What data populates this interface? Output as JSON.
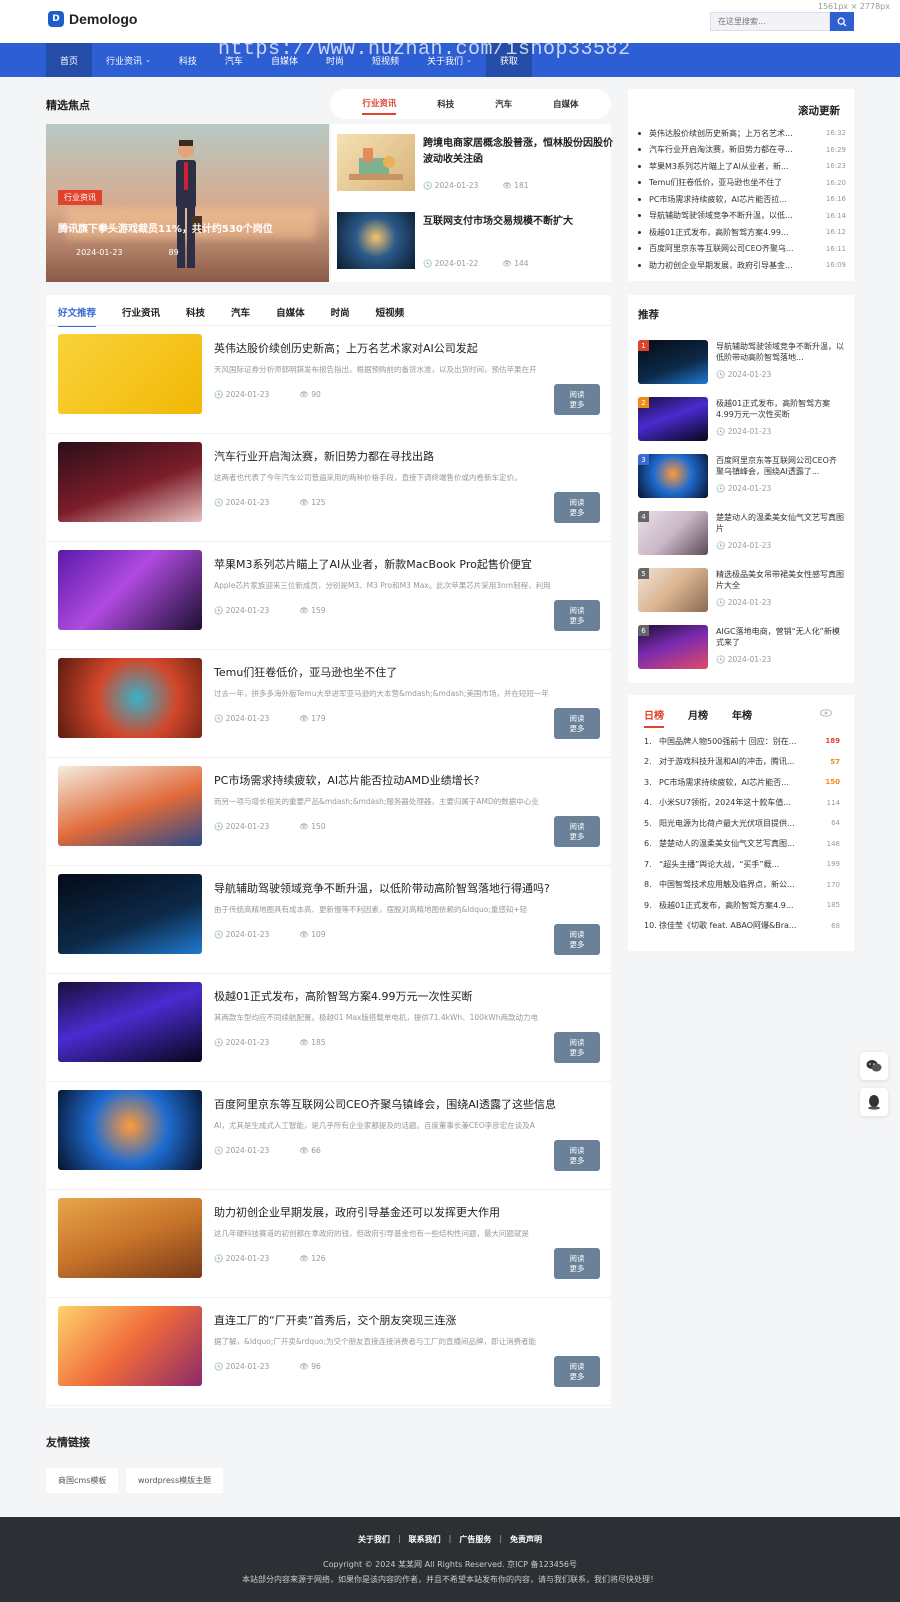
{
  "header": {
    "logo_mark": "D",
    "logo_text": "Demologo",
    "dims_label": "1561px × 2778px",
    "search_placeholder": "在这里搜索...",
    "watermark": "https://www.huzhan.com/ishop33582"
  },
  "nav": [
    "首页",
    "行业资讯",
    "科技",
    "汽车",
    "自媒体",
    "时尚",
    "短视频",
    "关于我们",
    "获取"
  ],
  "featured": {
    "title": "精选焦点",
    "tabs": [
      "行业资讯",
      "科技",
      "汽车",
      "自媒体"
    ],
    "hero": {
      "badge": "行业资讯",
      "title": "腾讯旗下拳头游戏裁员11%，共计约530个岗位",
      "date": "2024-01-23",
      "views": "89"
    },
    "side": [
      {
        "title": "跨境电商家居概念股普涨，恒林股份因股价波动收关注函",
        "date": "2024-01-23",
        "views": "181"
      },
      {
        "title": "互联网支付市场交易规模不断扩大",
        "date": "2024-01-22",
        "views": "144"
      }
    ]
  },
  "list": {
    "tabs": [
      "好文推荐",
      "行业资讯",
      "科技",
      "汽车",
      "自媒体",
      "时尚",
      "短视频"
    ],
    "button_label": "阅读\n更多",
    "articles": [
      {
        "title": "英伟达股价续创历史新高；上万名艺术家对AI公司发起",
        "excerpt": "天风国际证券分析师郭明錤发布报告指出，根据预购前的备货水准，以及出货时间，预估苹果在开",
        "date": "2024-01-23",
        "views": "90"
      },
      {
        "title": "汽车行业开启淘汰赛，新旧势力都在寻找出路",
        "excerpt": "这两者也代表了今年汽车公司普遍采用的两种价格手段，直接下调终端售价或内卷新车定价。",
        "date": "2024-01-23",
        "views": "125"
      },
      {
        "title": "苹果M3系列芯片瞄上了AI从业者，新款MacBook Pro起售价便宜",
        "excerpt": "Apple芯片家族迎来三位新成员，分别是M3、M3 Pro和M3 Max。此次苹果芯片采用3nm制程，利用",
        "date": "2024-01-23",
        "views": "159"
      },
      {
        "title": "Temu们狂卷低价，亚马逊也坐不住了",
        "excerpt": "过去一年，拼多多海外版Temu大举进军亚马逊的大本营&mdash;&mdash;美国市场，并在短短一年",
        "date": "2024-01-23",
        "views": "179"
      },
      {
        "title": "PC市场需求持续疲软，AI芯片能否拉动AMD业绩增长?",
        "excerpt": "而另一项与增长相关的重要产品&mdash;&mdash;服务器处理器，主要归属于AMD的数据中心业",
        "date": "2024-01-23",
        "views": "150"
      },
      {
        "title": "导航辅助驾驶领域竞争不断升温，以低阶带动高阶智驾落地行得通吗?",
        "excerpt": "由于传统高精地图具有成本高、更新慢等不利因素，摆脱对高精地图依赖的&ldquo;重感知+轻",
        "date": "2024-01-23",
        "views": "109"
      },
      {
        "title": "极越01正式发布，高阶智驾方案4.99万元一次性买断",
        "excerpt": "其两款车型均应不同续航配置。极越01 Max版搭载单电机，提供71.4kWh、100kWh两款动力电",
        "date": "2024-01-23",
        "views": "185"
      },
      {
        "title": "百度阿里京东等互联网公司CEO齐聚乌镇峰会，围绕AI透露了这些信息",
        "excerpt": "AI，尤其是生成式人工智能，是几乎所有企业家都提及的话题。百度董事长兼CEO李彦宏在谈及A",
        "date": "2024-01-23",
        "views": "66"
      },
      {
        "title": "助力初创企业早期发展，政府引导基金还可以发挥更大作用",
        "excerpt": "这几年硬科技赛道的初创都在拿政府的钱，但政府引导基金也有一些结构性问题，最大问题就是",
        "date": "2024-01-23",
        "views": "126"
      },
      {
        "title": "直连工厂的“厂开卖”首秀后，交个朋友突现三连涨",
        "excerpt": "据了解，&ldquo;厂开卖&rdquo;为交个朋友直接连接消费者与工厂的直播间品牌，即让消费者能",
        "date": "2024-01-23",
        "views": "96"
      }
    ]
  },
  "updates": {
    "title": "滚动更新",
    "items": [
      {
        "text": "英伟达股价续创历史新高；上万名艺术...",
        "time": "16:32"
      },
      {
        "text": "汽车行业开启淘汰赛，新旧势力都在寻...",
        "time": "16:29"
      },
      {
        "text": "苹果M3系列芯片瞄上了AI从业者，新...",
        "time": "16:23"
      },
      {
        "text": "Temu们狂卷低价，亚马逊也坐不住了",
        "time": "16:20"
      },
      {
        "text": "PC市场需求持续疲软，AI芯片能否拉...",
        "time": "16:16"
      },
      {
        "text": "导航辅助驾驶领域竞争不断升温，以低...",
        "time": "16:14"
      },
      {
        "text": "极越01正式发布，高阶智驾方案4.99...",
        "time": "16:12"
      },
      {
        "text": "百度阿里京东等互联网公司CEO齐聚乌...",
        "time": "16:11"
      },
      {
        "text": "助力初创企业早期发展，政府引导基金...",
        "time": "16:09"
      }
    ]
  },
  "recommend": {
    "title": "推荐",
    "items": [
      {
        "num": "1",
        "title": "导航辅助驾驶领域竞争不断升温，以低阶带动高阶智驾落地...",
        "date": "2024-01-23"
      },
      {
        "num": "2",
        "title": "极越01正式发布，高阶智驾方案4.99万元一次性买断",
        "date": "2024-01-23"
      },
      {
        "num": "3",
        "title": "百度阿里京东等互联网公司CEO齐聚乌镇峰会，围绕AI透露了...",
        "date": "2024-01-23"
      },
      {
        "num": "4",
        "title": "楚楚动人的温柔美女仙气文艺写真图片",
        "date": "2024-01-23"
      },
      {
        "num": "5",
        "title": "精选极品美女吊带裙美女性感写真图片大全",
        "date": "2024-01-23"
      },
      {
        "num": "6",
        "title": "AIGC落地电商，营销“无人化”新模式来了",
        "date": "2024-01-23"
      }
    ]
  },
  "ranking": {
    "tabs": [
      "日榜",
      "月榜",
      "年榜"
    ],
    "items": [
      {
        "n": "1.",
        "t": "中国品牌人物500强前十 回应：别在...",
        "v": "189",
        "level": "hot"
      },
      {
        "n": "2.",
        "t": "对于游戏科技升温和AI的冲击，腾讯...",
        "v": "57",
        "level": "warm"
      },
      {
        "n": "3.",
        "t": "PC市场需求持续疲软，AI芯片能否...",
        "v": "150",
        "level": "warm"
      },
      {
        "n": "4.",
        "t": "小米SU7领衔，2024年这十款车值...",
        "v": "114",
        "level": ""
      },
      {
        "n": "5.",
        "t": "阳光电源为比荷卢最大光伏项目提供...",
        "v": "64",
        "level": ""
      },
      {
        "n": "6.",
        "t": "楚楚动人的温柔美女仙气文艺写真图...",
        "v": "148",
        "level": ""
      },
      {
        "n": "7.",
        "t": "“超头主播”舆论大战，“买手”概...",
        "v": "199",
        "level": ""
      },
      {
        "n": "8.",
        "t": "中国智驾技术应用触及临界点，新公...",
        "v": "170",
        "level": ""
      },
      {
        "n": "9.",
        "t": "极越01正式发布，高阶智驾方案4.9...",
        "v": "185",
        "level": ""
      },
      {
        "n": "10.",
        "t": "徐佳莹《切歌 feat. ABAO阿爆&Bra...",
        "v": "68",
        "level": ""
      }
    ]
  },
  "links": {
    "title": "友情链接",
    "items": [
      "商国cms模板",
      "wordpress模版主题"
    ]
  },
  "footer": {
    "links": [
      "关于我们",
      "联系我们",
      "广告服务",
      "免责声明"
    ],
    "sep": "|",
    "copyright": "Copyright © 2024 某某网 All Rights Reserved. 京ICP 备123456号",
    "note": "本站部分内容来源于网络，如果你是该内容的作者，并且不希望本站发布你的内容，请与我们联系，我们将尽快处理！"
  },
  "colors": {
    "primary": "#2e5ed3",
    "accent": "#e0432c",
    "button": "#6b8199",
    "footer": "#2c2f33"
  }
}
